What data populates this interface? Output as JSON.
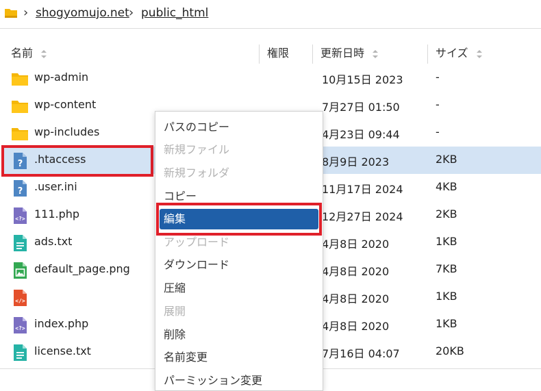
{
  "breadcrumb": {
    "home_icon": "home-folder-icon",
    "items": [
      "shogyomujo.net",
      "public_html"
    ]
  },
  "table": {
    "headers": {
      "name": "名前",
      "permission": "権限",
      "modified": "更新日時",
      "size": "サイズ"
    },
    "rows": [
      {
        "name": "wp-admin",
        "date": "10月15日 2023",
        "size": "-",
        "icon": "folder-icon"
      },
      {
        "name": "wp-content",
        "date": "7月27日 01:50",
        "size": "-",
        "icon": "folder-icon"
      },
      {
        "name": "wp-includes",
        "date": "4月23日 09:44",
        "size": "-",
        "icon": "folder-icon"
      },
      {
        "name": ".htaccess",
        "date": "8月9日 2023",
        "size": "2KB",
        "icon": "unknown-file-icon",
        "selected": true
      },
      {
        "name": ".user.ini",
        "date": "11月17日 2024",
        "size": "4KB",
        "icon": "unknown-file-icon"
      },
      {
        "name": "111.php",
        "date": "12月27日 2024",
        "size": "2KB",
        "icon": "php-file-icon"
      },
      {
        "name": "ads.txt",
        "date": "4月8日 2020",
        "size": "1KB",
        "icon": "text-file-icon"
      },
      {
        "name": "default_page.png",
        "date": "4月8日 2020",
        "size": "7KB",
        "icon": "image-file-icon"
      },
      {
        "name": "",
        "date": "4月8日 2020",
        "size": "1KB",
        "icon": "html-file-icon"
      },
      {
        "name": "index.php",
        "date": "4月8日 2020",
        "size": "1KB",
        "icon": "php-file-icon"
      },
      {
        "name": "license.txt",
        "date": "7月16日 04:07",
        "size": "20KB",
        "icon": "text-file-icon"
      }
    ]
  },
  "context_menu": {
    "items": [
      {
        "label": "パスのコピー",
        "state": "enabled"
      },
      {
        "label": "新規ファイル",
        "state": "disabled"
      },
      {
        "label": "新規フォルダ",
        "state": "disabled"
      },
      {
        "label": "コピー",
        "state": "enabled"
      },
      {
        "label": "編集",
        "state": "active"
      },
      {
        "label": "アップロード",
        "state": "disabled"
      },
      {
        "label": "ダウンロード",
        "state": "enabled"
      },
      {
        "label": "圧縮",
        "state": "enabled"
      },
      {
        "label": "展開",
        "state": "disabled"
      },
      {
        "label": "削除",
        "state": "enabled"
      },
      {
        "label": "名前変更",
        "state": "enabled"
      },
      {
        "label": "パーミッション変更",
        "state": "enabled"
      }
    ]
  },
  "colors": {
    "folder": "#f5b70a",
    "unknown_file": "#4e86c4",
    "php_file": "#7b6fc2",
    "text_file": "#26b3a6",
    "image_file": "#33a852",
    "html_file": "#e4502b",
    "selection": "#d3e3f4",
    "menu_active": "#1f5fa8",
    "highlight": "#e0202a"
  }
}
